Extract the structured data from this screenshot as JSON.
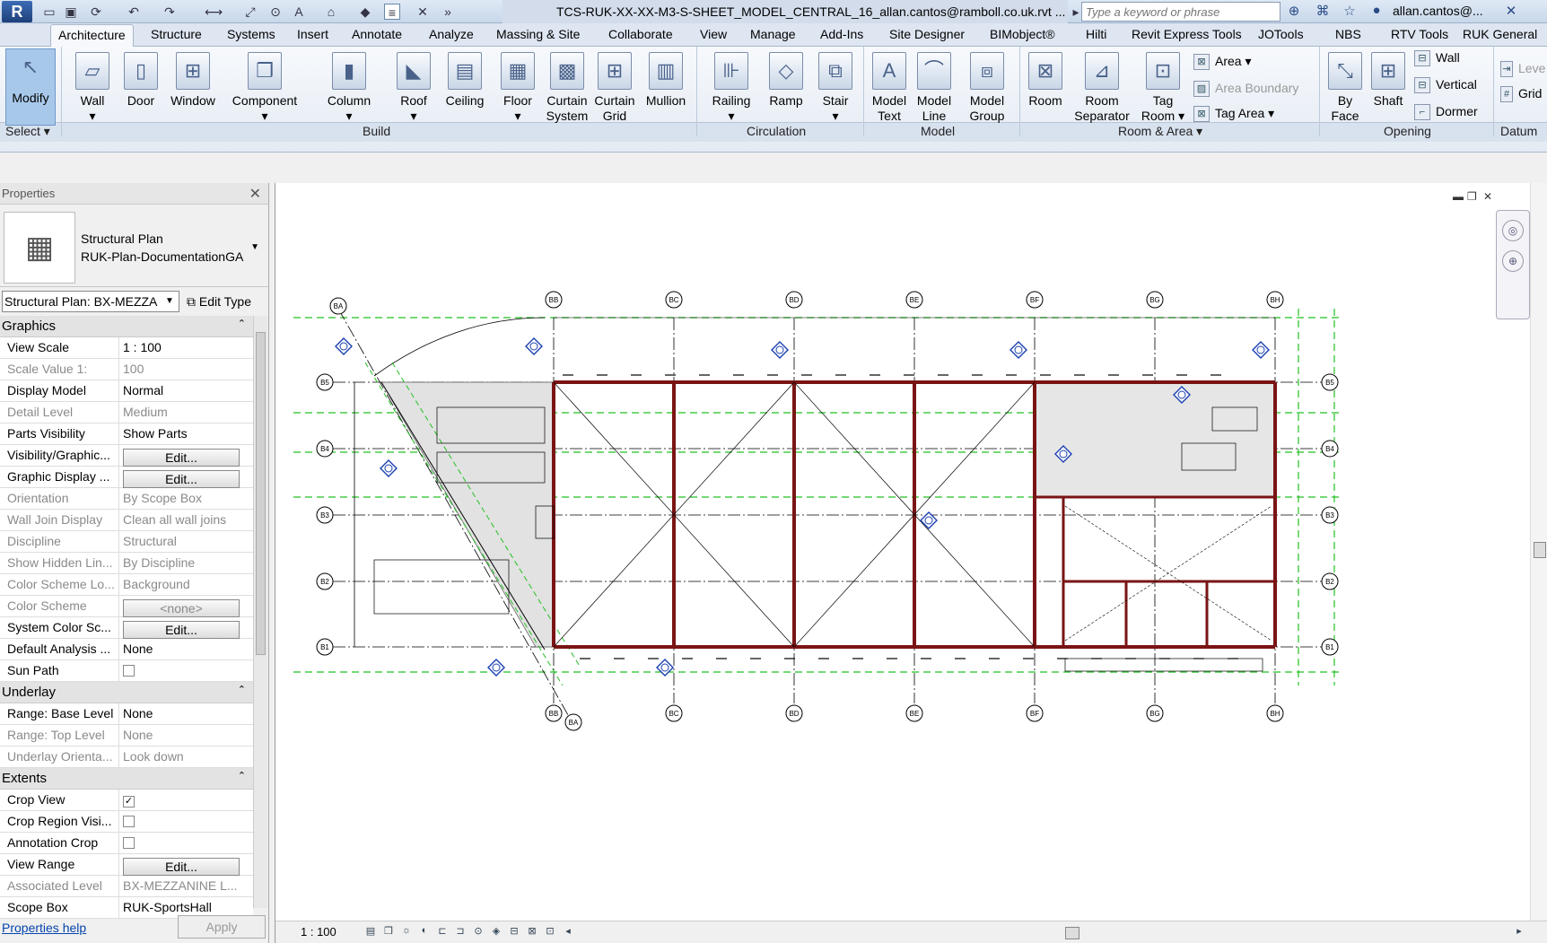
{
  "titlebar": {
    "app_logo": "R",
    "document_title": "TCS-RUK-XX-XX-M3-S-SHEET_MODEL_CENTRAL_16_allan.cantos@ramboll.co.uk.rvt ...",
    "search_placeholder": "Type a keyword or phrase",
    "user": "allan.cantos@...",
    "icons": [
      "open-icon",
      "save-icon",
      "sync-icon",
      "undo-icon",
      "redo-icon",
      "measure-icon",
      "dimension-icon",
      "tag-icon",
      "text-icon",
      "3d-view-icon",
      "section-icon",
      "thin-lines-icon",
      "close-hidden-icon",
      "switch-windows-icon"
    ]
  },
  "ribbon_tabs": [
    "Architecture",
    "Structure",
    "Systems",
    "Insert",
    "Annotate",
    "Analyze",
    "Massing & Site",
    "Collaborate",
    "View",
    "Manage",
    "Add-Ins",
    "Site Designer",
    "BIMobject®",
    "Hilti",
    "Revit Express Tools",
    "JOTools",
    "NBS",
    "RTV Tools",
    "RUK General"
  ],
  "active_tab": "Architecture",
  "ribbon": {
    "modify": "Modify",
    "select": "Select",
    "build": [
      {
        "label": "Wall",
        "icon": "wall-icon"
      },
      {
        "label": "Door",
        "icon": "door-icon"
      },
      {
        "label": "Window",
        "icon": "window-icon"
      },
      {
        "label": "Component",
        "icon": "component-icon"
      },
      {
        "label": "Column",
        "icon": "column-icon"
      },
      {
        "label": "Roof",
        "icon": "roof-icon"
      },
      {
        "label": "Ceiling",
        "icon": "ceiling-icon"
      },
      {
        "label": "Floor",
        "icon": "floor-icon"
      },
      {
        "label": "Curtain System",
        "l1": "Curtain",
        "l2": "System",
        "icon": "curtain-system-icon"
      },
      {
        "label": "Curtain Grid",
        "l1": "Curtain",
        "l2": "Grid",
        "icon": "curtain-grid-icon"
      },
      {
        "label": "Mullion",
        "icon": "mullion-icon"
      }
    ],
    "circulation": [
      {
        "label": "Railing",
        "icon": "railing-icon"
      },
      {
        "label": "Ramp",
        "icon": "ramp-icon"
      },
      {
        "label": "Stair",
        "icon": "stair-icon"
      }
    ],
    "model": [
      {
        "l1": "Model",
        "l2": "Text",
        "icon": "model-text-icon"
      },
      {
        "l1": "Model",
        "l2": "Line",
        "icon": "model-line-icon"
      },
      {
        "l1": "Model",
        "l2": "Group",
        "icon": "model-group-icon"
      }
    ],
    "room_area": {
      "room": "Room",
      "room_separator_l1": "Room",
      "room_separator_l2": "Separator",
      "tag_room_l1": "Tag",
      "tag_room_l2": "Room",
      "area": "Area",
      "area_boundary": "Area  Boundary",
      "tag_area": "Tag  Area"
    },
    "opening": {
      "by_face_l1": "By",
      "by_face_l2": "Face",
      "shaft": "Shaft",
      "wall": "Wall",
      "vertical": "Vertical",
      "dormer": "Dormer"
    },
    "datum": {
      "level": "Leve",
      "grid": "Grid"
    },
    "panels": {
      "build": "Build",
      "circulation": "Circulation",
      "model": "Model",
      "room_area": "Room & Area",
      "opening": "Opening",
      "datum": "Datum"
    }
  },
  "properties": {
    "title": "Properties",
    "type_line1": "Structural Plan",
    "type_line2": "RUK-Plan-DocumentationGA",
    "view_selector": "Structural Plan: BX-MEZZA",
    "edit_type": "Edit Type",
    "help": "Properties help",
    "apply": "Apply",
    "groups": {
      "graphics": "Graphics",
      "underlay": "Underlay",
      "extents": "Extents"
    },
    "rows_graphics": [
      {
        "label": "View Scale",
        "value": "1 : 100",
        "dim": false
      },
      {
        "label": "Scale Value    1:",
        "value": "100",
        "dim": true
      },
      {
        "label": "Display Model",
        "value": "Normal",
        "dim": false
      },
      {
        "label": "Detail Level",
        "value": "Medium",
        "dim": true
      },
      {
        "label": "Parts Visibility",
        "value": "Show Parts",
        "dim": false
      },
      {
        "label": "Visibility/Graphic...",
        "value": "Edit...",
        "button": true,
        "dim": false
      },
      {
        "label": "Graphic Display ...",
        "value": "Edit...",
        "button": true,
        "dim": false
      },
      {
        "label": "Orientation",
        "value": "By Scope Box",
        "dim": true
      },
      {
        "label": "Wall Join Display",
        "value": "Clean all wall joins",
        "dim": true
      },
      {
        "label": "Discipline",
        "value": "Structural",
        "dim": true
      },
      {
        "label": "Show Hidden Lin...",
        "value": "By Discipline",
        "dim": true
      },
      {
        "label": "Color Scheme Lo...",
        "value": "Background",
        "dim": true
      },
      {
        "label": "Color Scheme",
        "value": "<none>",
        "button": true,
        "dim": true
      },
      {
        "label": "System Color Sc...",
        "value": "Edit...",
        "button": true,
        "dim": false
      },
      {
        "label": "Default Analysis ...",
        "value": "None",
        "dim": false
      },
      {
        "label": "Sun Path",
        "value": "",
        "checkbox": true,
        "checked": false,
        "dim": false
      }
    ],
    "rows_underlay": [
      {
        "label": "Range: Base Level",
        "value": "None",
        "dim": false
      },
      {
        "label": "Range: Top Level",
        "value": "None",
        "dim": true
      },
      {
        "label": "Underlay Orienta...",
        "value": "Look down",
        "dim": true
      }
    ],
    "rows_extents": [
      {
        "label": "Crop View",
        "value": "",
        "checkbox": true,
        "checked": true,
        "dim": false
      },
      {
        "label": "Crop Region Visi...",
        "value": "",
        "checkbox": true,
        "checked": false,
        "dim": false
      },
      {
        "label": "Annotation Crop",
        "value": "",
        "checkbox": true,
        "checked": false,
        "dim": false
      },
      {
        "label": "View Range",
        "value": "Edit...",
        "button": true,
        "dim": false
      },
      {
        "label": "Associated Level",
        "value": "BX-MEZZANINE L...",
        "dim": true
      },
      {
        "label": "Scope Box",
        "value": "RUK-SportsHall",
        "dim": false
      }
    ]
  },
  "view": {
    "scale": "1 : 100",
    "grids_top": [
      "BB",
      "BC",
      "BD",
      "BE",
      "BF",
      "BG",
      "BH"
    ],
    "grids_left": [
      "B5",
      "B4",
      "B3",
      "B2",
      "B1"
    ],
    "grid_ba": "BA",
    "grid_color": "#000000",
    "wall_color": "#7a1414",
    "scope_color": "#22c022",
    "tag_color": "#1a3fb0"
  }
}
